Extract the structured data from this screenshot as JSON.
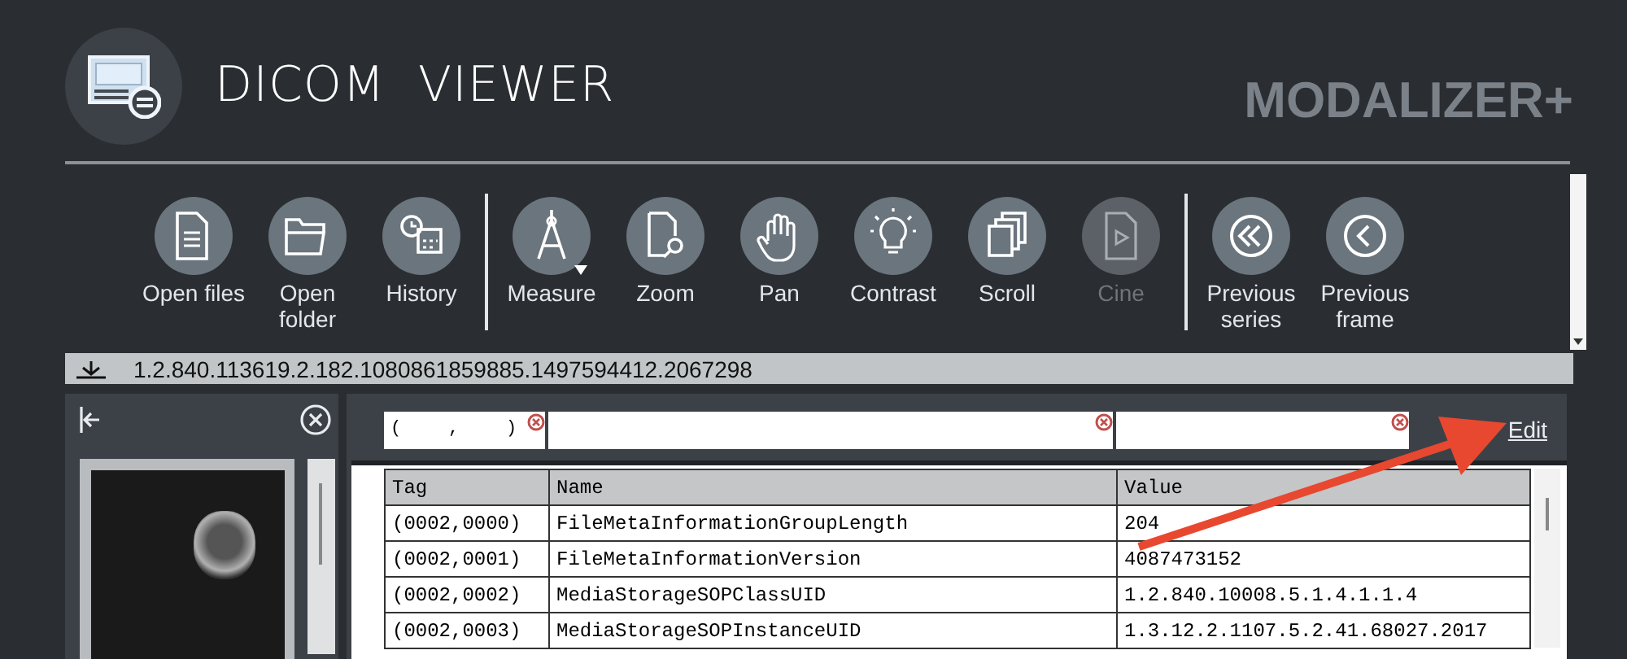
{
  "header": {
    "title": "DICOM  VIEWER",
    "brand": "MODALIZER+"
  },
  "toolbar": {
    "groups": [
      {
        "buttons": [
          {
            "label": "Open files",
            "disabled": false,
            "dropdown": false
          },
          {
            "label": "Open folder",
            "disabled": false,
            "dropdown": false
          },
          {
            "label": "History",
            "disabled": false,
            "dropdown": false
          }
        ]
      },
      {
        "buttons": [
          {
            "label": "Measure",
            "disabled": false,
            "dropdown": true
          },
          {
            "label": "Zoom",
            "disabled": false,
            "dropdown": false
          },
          {
            "label": "Pan",
            "disabled": false,
            "dropdown": false
          },
          {
            "label": "Contrast",
            "disabled": false,
            "dropdown": false
          },
          {
            "label": "Scroll",
            "disabled": false,
            "dropdown": false
          },
          {
            "label": "Cine",
            "disabled": true,
            "dropdown": false
          }
        ]
      },
      {
        "buttons": [
          {
            "label": "Previous series",
            "disabled": false,
            "dropdown": false
          },
          {
            "label": "Previous frame",
            "disabled": false,
            "dropdown": false
          }
        ]
      }
    ]
  },
  "path_bar": {
    "text": "1.2.840.113619.2.182.1080861859885.1497594412.2067298"
  },
  "filters": [
    {
      "kind": "tag",
      "value": "(    ,    )"
    },
    {
      "kind": "text"
    },
    {
      "kind": "text"
    }
  ],
  "edit_link": "Edit",
  "table": {
    "columns": [
      "Tag",
      "Name",
      "Value"
    ],
    "rows": [
      [
        "(0002,0000)",
        "FileMetaInformationGroupLength",
        "204"
      ],
      [
        "(0002,0001)",
        "FileMetaInformationVersion",
        "4087473152"
      ],
      [
        "(0002,0002)",
        "MediaStorageSOPClassUID",
        "1.2.840.10008.5.1.4.1.1.4"
      ],
      [
        "(0002,0003)",
        "MediaStorageSOPInstanceUID",
        "1.3.12.2.1107.5.2.41.68027.2017"
      ]
    ]
  }
}
